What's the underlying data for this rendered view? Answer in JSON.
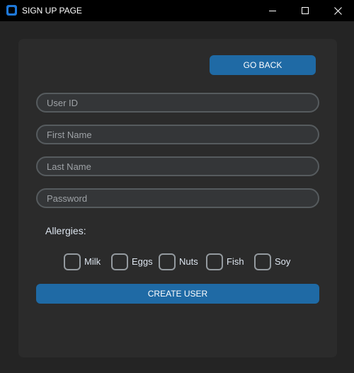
{
  "window": {
    "title": "SIGN UP PAGE",
    "controls": {
      "minimize": "minimize-icon",
      "maximize": "maximize-icon",
      "close": "close-icon"
    }
  },
  "form": {
    "go_back_label": "GO BACK",
    "fields": {
      "user_id": {
        "placeholder": "User ID",
        "value": ""
      },
      "first_name": {
        "placeholder": "First Name",
        "value": ""
      },
      "last_name": {
        "placeholder": "Last Name",
        "value": ""
      },
      "password": {
        "placeholder": "Password",
        "value": ""
      }
    },
    "allergies_label": "Allergies:",
    "allergies": [
      {
        "label": "Milk",
        "checked": false
      },
      {
        "label": "Eggs",
        "checked": false
      },
      {
        "label": "Nuts",
        "checked": false
      },
      {
        "label": "Fish",
        "checked": false
      },
      {
        "label": "Soy",
        "checked": false
      }
    ],
    "create_label": "CREATE USER"
  },
  "colors": {
    "accent": "#1f6aa5",
    "background": "#242424",
    "frame": "#2b2b2b",
    "field_bg": "#343638",
    "field_border": "#565b5e",
    "checkbox_border": "#949a9f",
    "text": "#dce4ee"
  }
}
